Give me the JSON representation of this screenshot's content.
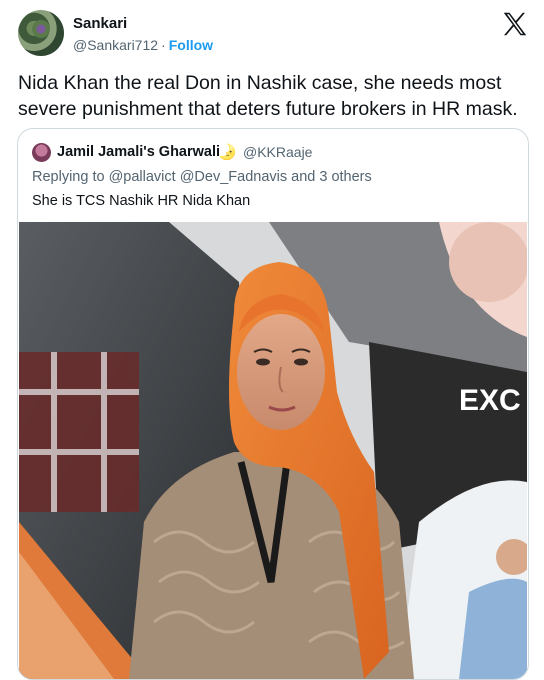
{
  "author": {
    "name": "Sankari",
    "handle": "@Sankari712",
    "separator": "·",
    "follow_label": "Follow"
  },
  "platform_icon": "x-logo-icon",
  "tweet": {
    "text": "Nida Khan the real Don in Nashik case, she needs most severe punishment that deters future brokers in HR mask."
  },
  "quoted_tweet": {
    "author_name": "Jamil Jamali's Gharwali",
    "emoji": "🌛",
    "handle": "@KKRaaje",
    "reply_context": "Replying to @pallavict @Dev_Fadnavis and 3 others",
    "text": "She is TCS Nashik HR Nida Khan",
    "photo": {
      "banner_text": "EXC",
      "description_icon": "photo-woman-orange-hijab"
    }
  },
  "colors": {
    "link": "#1d9bf0",
    "secondary_text": "#536471",
    "border": "#cfd9de",
    "hijab_orange": "#e8732c"
  }
}
